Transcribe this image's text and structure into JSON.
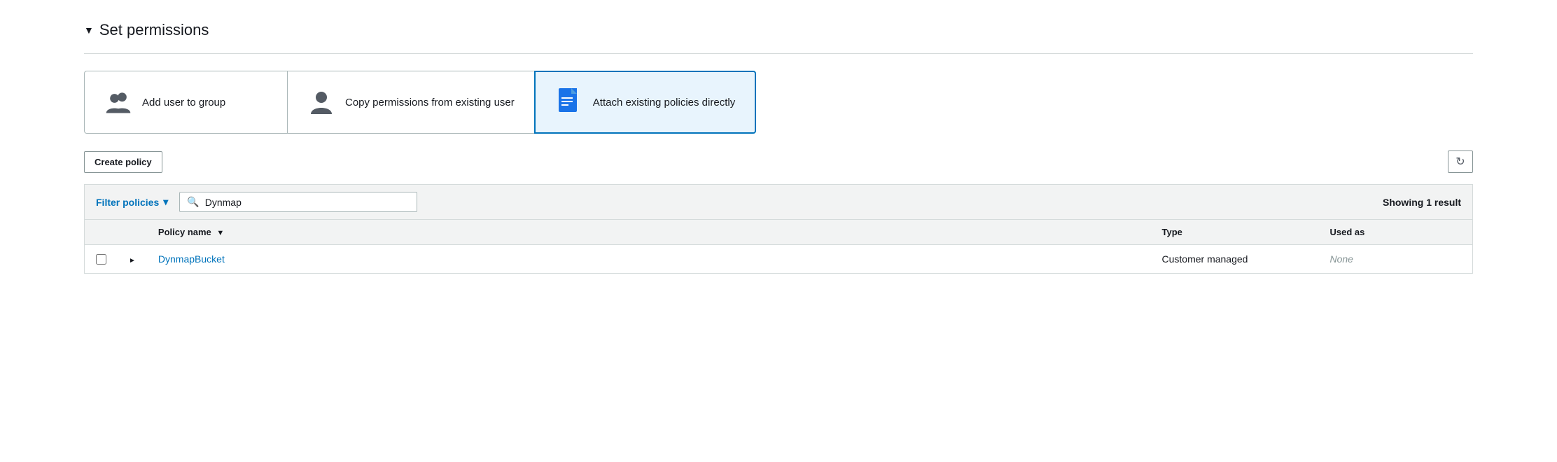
{
  "section": {
    "title": "Set permissions",
    "chevron": "▼"
  },
  "permission_cards": [
    {
      "id": "add-user-to-group",
      "label": "Add user to group",
      "icon_type": "users",
      "active": false
    },
    {
      "id": "copy-permissions",
      "label": "Copy permissions from existing user",
      "icon_type": "user",
      "active": false
    },
    {
      "id": "attach-policies",
      "label": "Attach existing policies directly",
      "icon_type": "document",
      "active": true
    }
  ],
  "toolbar": {
    "create_policy_label": "Create policy",
    "refresh_icon": "↻"
  },
  "filter_bar": {
    "filter_label": "Filter policies",
    "chevron": "▾",
    "search_placeholder": "Dynmap",
    "search_value": "Dynmap",
    "showing_result": "Showing 1 result"
  },
  "table": {
    "columns": [
      {
        "id": "checkbox",
        "label": ""
      },
      {
        "id": "expand",
        "label": ""
      },
      {
        "id": "name",
        "label": "Policy name",
        "sortable": true,
        "sort_icon": "▼"
      },
      {
        "id": "type",
        "label": "Type"
      },
      {
        "id": "usedas",
        "label": "Used as"
      }
    ],
    "rows": [
      {
        "id": "dynmap-bucket",
        "name": "DynmapBucket",
        "type": "Customer managed",
        "used_as": "None"
      }
    ]
  }
}
